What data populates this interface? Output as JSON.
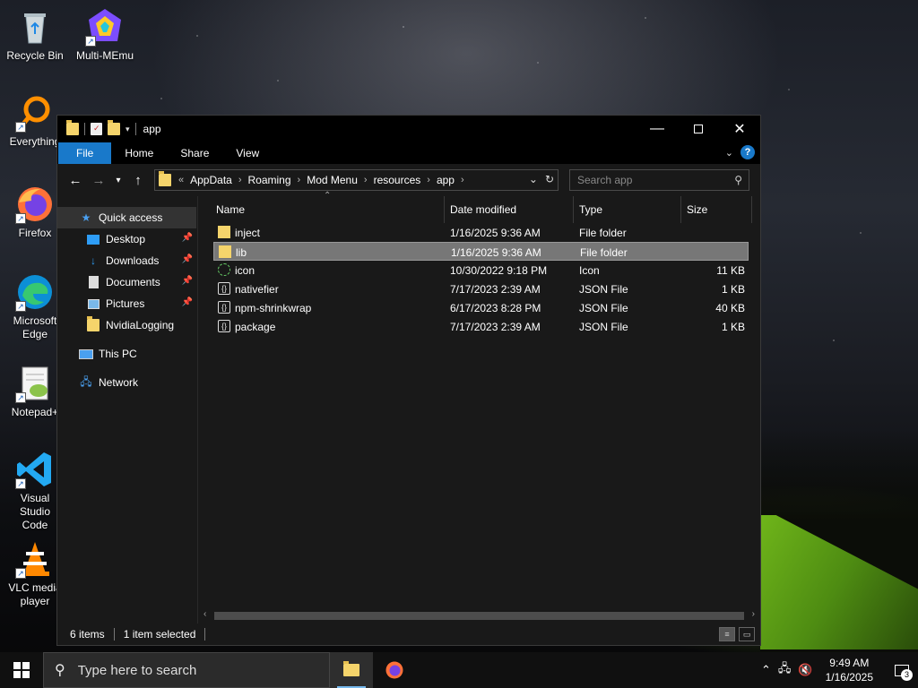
{
  "desktop": {
    "icons": [
      {
        "label": "Recycle Bin",
        "icon": "recycle-bin-icon"
      },
      {
        "label": "Multi-MEmu",
        "icon": "memu-icon"
      },
      {
        "label": "Everything",
        "icon": "everything-icon"
      },
      {
        "label": "Firefox",
        "icon": "firefox-icon"
      },
      {
        "label": "Microsoft Edge",
        "icon": "edge-icon"
      },
      {
        "label": "Notepad+",
        "icon": "notepadpp-icon"
      },
      {
        "label": "Visual Studio Code",
        "icon": "vscode-icon"
      },
      {
        "label": "VLC media player",
        "icon": "vlc-icon"
      }
    ]
  },
  "window": {
    "title": "app",
    "ribbon_tabs": [
      "File",
      "Home",
      "Share",
      "View"
    ],
    "breadcrumb_prefix": "«",
    "breadcrumb": [
      "AppData",
      "Roaming",
      "Mod Menu",
      "resources",
      "app"
    ],
    "search_placeholder": "Search app",
    "nav": {
      "quick_access": "Quick access",
      "pinned": [
        "Desktop",
        "Downloads",
        "Documents",
        "Pictures"
      ],
      "unpinned": [
        "NvidiaLogging"
      ],
      "this_pc": "This PC",
      "network": "Network"
    },
    "columns": {
      "name": "Name",
      "date": "Date modified",
      "type": "Type",
      "size": "Size"
    },
    "files": [
      {
        "name": "inject",
        "date": "1/16/2025 9:36 AM",
        "type": "File folder",
        "size": "",
        "icon": "folder-icon"
      },
      {
        "name": "lib",
        "date": "1/16/2025 9:36 AM",
        "type": "File folder",
        "size": "",
        "icon": "folder-icon"
      },
      {
        "name": "icon",
        "date": "10/30/2022 9:18 PM",
        "type": "Icon",
        "size": "11 KB",
        "icon": "ico-file-icon"
      },
      {
        "name": "nativefier",
        "date": "7/17/2023 2:39 AM",
        "type": "JSON File",
        "size": "1 KB",
        "icon": "json-file-icon"
      },
      {
        "name": "npm-shrinkwrap",
        "date": "6/17/2023 8:28 PM",
        "type": "JSON File",
        "size": "40 KB",
        "icon": "json-file-icon"
      },
      {
        "name": "package",
        "date": "7/17/2023 2:39 AM",
        "type": "JSON File",
        "size": "1 KB",
        "icon": "json-file-icon"
      }
    ],
    "status": {
      "items": "6 items",
      "selected": "1 item selected"
    }
  },
  "taskbar": {
    "search_placeholder": "Type here to search",
    "time": "9:49 AM",
    "date": "1/16/2025",
    "notification_count": "3"
  },
  "colors": {
    "accent": "#1979ca",
    "selection": "#777777",
    "folder": "#f5d46b"
  }
}
